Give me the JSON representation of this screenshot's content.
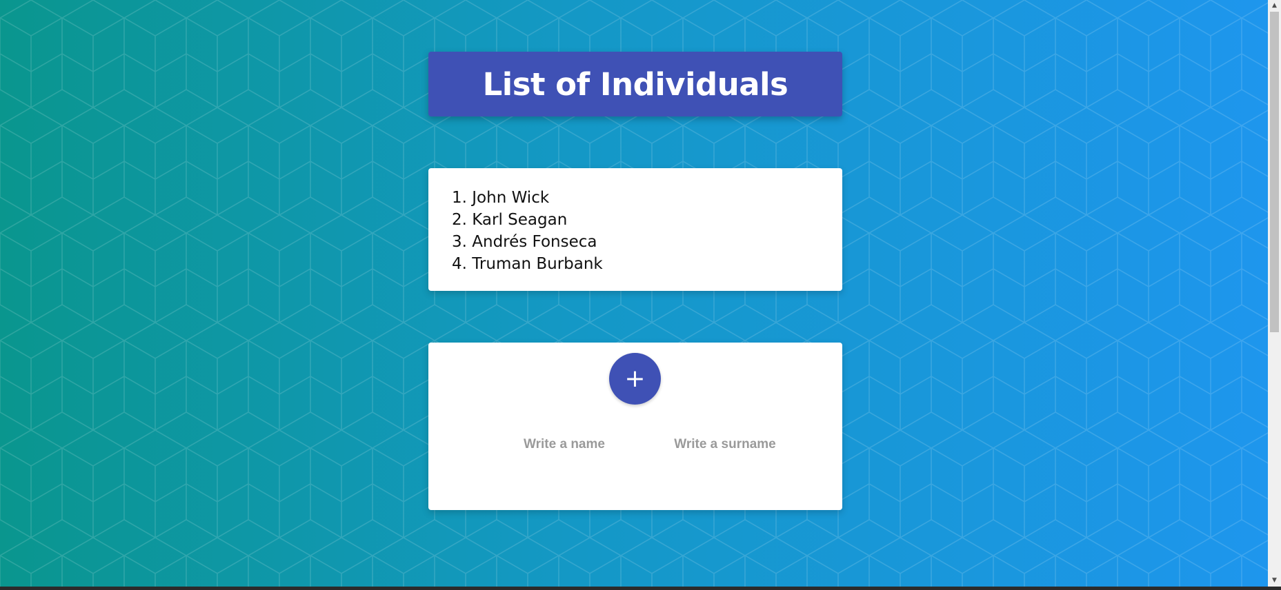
{
  "header": {
    "title": "List of Individuals"
  },
  "people": [
    {
      "label": "1. John Wick"
    },
    {
      "label": "2. Karl Seagan"
    },
    {
      "label": "3. Andrés Fonseca"
    },
    {
      "label": "4. Truman Burbank"
    }
  ],
  "form": {
    "add_button_label": "+",
    "name_placeholder": "Write a name",
    "surname_placeholder": "Write a surname"
  },
  "colors": {
    "accent": "#3f51b5",
    "background_start": "#0a968e",
    "background_end": "#1e96ee",
    "card": "#ffffff"
  },
  "scrollbar": {
    "up_icon": "arrow-up-icon",
    "down_icon": "arrow-down-icon"
  }
}
